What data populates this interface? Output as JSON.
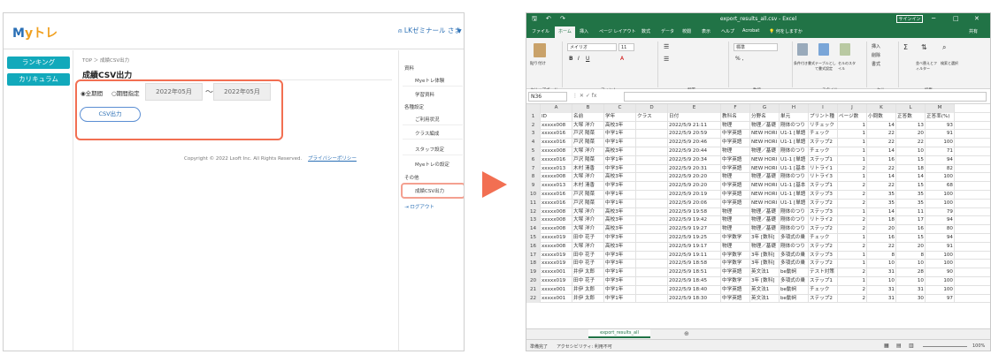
{
  "left": {
    "logo_main": "M",
    "logo_accent": "yトレ",
    "user_name": "LKゼミナール さま",
    "user_drop": "▼",
    "sidebar": [
      "ランキング",
      "カリキュラム"
    ],
    "breadcrumb": "TOP ＞ 成績CSV出力",
    "page_title": "成績CSV出力",
    "radio_all": "◉全期間",
    "radio_range": "○期間指定",
    "date_from": "2022年05月",
    "date_sep": "〜",
    "date_to": "2022年05月",
    "csv_button": "CSV出力",
    "footer_copy": "Copyright © 2022 Lsoft Inc. All Rights Reserved.",
    "footer_link": "プライバシーポリシー",
    "rside": {
      "sec1": "資料",
      "sec1_items": [
        "Myeトレ体験",
        "学習資料"
      ],
      "sec2": "各種設定",
      "sec2_items": [
        "ご利用状況",
        "クラス編成",
        "スタッフ設定",
        "Myeトレの設定"
      ],
      "sec3": "その他",
      "sec3_items": [
        "成績CSV出力"
      ],
      "logout": "⇥ ログアウト"
    }
  },
  "excel": {
    "title": "export_results_all.csv - Excel",
    "signin": "サインイン",
    "window_controls": [
      "─",
      "□",
      "✕"
    ],
    "tabs": [
      "ファイル",
      "ホーム",
      "挿入",
      "ページ レイアウト",
      "数式",
      "データ",
      "校閲",
      "表示",
      "ヘルプ",
      "Acrobat",
      "💡 何をしますか"
    ],
    "share": "共有",
    "ribbon_groups": [
      "クリップボード",
      "フォント",
      "配置",
      "数値",
      "スタイル",
      "セル",
      "編集"
    ],
    "font_name": "メイリオ",
    "font_size": "11",
    "number_format": "標準",
    "ribbon_labels": [
      "貼り付け",
      "条件付き書式",
      "テーブルとして書式設定",
      "セルのスタイル",
      "挿入",
      "削除",
      "書式",
      "並べ替えとフィルター",
      "検索と選択"
    ],
    "name_box": "N36",
    "formula_icons": "⋮   ✕  ✓  fx",
    "columns": [
      "A",
      "B",
      "C",
      "D",
      "E",
      "F",
      "G",
      "H",
      "I",
      "J",
      "K",
      "L",
      "M"
    ],
    "rows": [
      [
        "ID",
        "名前",
        "学年",
        "クラス",
        "日付",
        "教科名",
        "分野名",
        "単元",
        "プリント種",
        "ページ数",
        "小問数",
        "正答数",
        "正答率(%)"
      ],
      [
        "xxxxx008",
        "大塚 洋介",
        "高校3年",
        "",
        "2022/5/9 21:11",
        "物理",
        "物理／基礎",
        "剛体のつり",
        "リチェック",
        "1",
        "14",
        "13",
        "93"
      ],
      [
        "xxxxx016",
        "戸沢 陽菜",
        "中学1年",
        "",
        "2022/5/9 20:59",
        "中学英語",
        "NEW HORI",
        "U1-1 [単語",
        "チェック",
        "1",
        "22",
        "20",
        "91"
      ],
      [
        "xxxxx016",
        "戸沢 陽菜",
        "中学1年",
        "",
        "2022/5/9 20:46",
        "中学英語",
        "NEW HORI",
        "U1-1 [単語",
        "ステップ2",
        "1",
        "22",
        "22",
        "100"
      ],
      [
        "xxxxx008",
        "大塚 洋介",
        "高校3年",
        "",
        "2022/5/9 20:44",
        "物理",
        "物理／基礎",
        "剛体のつり",
        "チェック",
        "1",
        "14",
        "10",
        "71"
      ],
      [
        "xxxxx016",
        "戸沢 陽菜",
        "中学1年",
        "",
        "2022/5/9 20:34",
        "中学英語",
        "NEW HORI",
        "U1-1 [単語",
        "ステップ1",
        "1",
        "16",
        "15",
        "94"
      ],
      [
        "xxxxx013",
        "木村 清香",
        "中学3年",
        "",
        "2022/5/9 20:31",
        "中学英語",
        "NEW HORI",
        "U1-1 [基本",
        "リトライ1",
        "2",
        "22",
        "18",
        "82"
      ],
      [
        "xxxxx008",
        "大塚 洋介",
        "高校3年",
        "",
        "2022/5/9 20:20",
        "物理",
        "物理／基礎",
        "剛体のつり",
        "リトライ3",
        "1",
        "14",
        "14",
        "100"
      ],
      [
        "xxxxx013",
        "木村 清香",
        "中学3年",
        "",
        "2022/5/9 20:20",
        "中学英語",
        "NEW HORI",
        "U1-1 [基本",
        "ステップ1",
        "2",
        "22",
        "15",
        "68"
      ],
      [
        "xxxxx016",
        "戸沢 陽菜",
        "中学1年",
        "",
        "2022/5/9 20:19",
        "中学英語",
        "NEW HORI",
        "U1-1 [単語",
        "ステップ3",
        "2",
        "35",
        "35",
        "100"
      ],
      [
        "xxxxx016",
        "戸沢 陽菜",
        "中学1年",
        "",
        "2022/5/9 20:06",
        "中学英語",
        "NEW HORI",
        "U1-1 [単語",
        "ステップ2",
        "2",
        "35",
        "35",
        "100"
      ],
      [
        "xxxxx008",
        "大塚 洋介",
        "高校3年",
        "",
        "2022/5/9 19:58",
        "物理",
        "物理／基礎",
        "剛体のつり",
        "ステップ3",
        "1",
        "14",
        "11",
        "79"
      ],
      [
        "xxxxx008",
        "大塚 洋介",
        "高校3年",
        "",
        "2022/5/9 19:42",
        "物理",
        "物理／基礎",
        "剛体のつり",
        "リトライ2",
        "2",
        "18",
        "17",
        "94"
      ],
      [
        "xxxxx008",
        "大塚 洋介",
        "高校3年",
        "",
        "2022/5/9 19:27",
        "物理",
        "物理／基礎",
        "剛体のつり",
        "ステップ2",
        "2",
        "20",
        "16",
        "80"
      ],
      [
        "xxxxx019",
        "田中 花子",
        "中学3年",
        "",
        "2022/5/9 19:25",
        "中学数学",
        "3年 [数科]",
        "多項式の乗",
        "チェック",
        "1",
        "16",
        "15",
        "94"
      ],
      [
        "xxxxx008",
        "大塚 洋介",
        "高校3年",
        "",
        "2022/5/9 19:17",
        "物理",
        "物理／基礎",
        "剛体のつり",
        "ステップ2",
        "2",
        "22",
        "20",
        "91"
      ],
      [
        "xxxxx019",
        "田中 花子",
        "中学3年",
        "",
        "2022/5/9 19:11",
        "中学数学",
        "3年 [数科]",
        "多項式の乗",
        "ステップ3",
        "1",
        "8",
        "8",
        "100"
      ],
      [
        "xxxxx019",
        "田中 花子",
        "中学3年",
        "",
        "2022/5/9 18:58",
        "中学数学",
        "3年 [数科]",
        "多項式の乗",
        "ステップ2",
        "1",
        "10",
        "10",
        "100"
      ],
      [
        "xxxxx001",
        "井伊 太郎",
        "中学1年",
        "",
        "2022/5/9 18:51",
        "中学英語",
        "英文法1",
        "be動詞",
        "テスト対策",
        "2",
        "31",
        "28",
        "90"
      ],
      [
        "xxxxx019",
        "田中 花子",
        "中学3年",
        "",
        "2022/5/9 18:45",
        "中学数学",
        "3年 [数科]",
        "多項式の乗",
        "ステップ1",
        "1",
        "10",
        "10",
        "100"
      ],
      [
        "xxxxx001",
        "井伊 太郎",
        "中学1年",
        "",
        "2022/5/9 18:40",
        "中学英語",
        "英文法1",
        "be動詞",
        "チェック",
        "2",
        "31",
        "31",
        "100"
      ],
      [
        "xxxxx001",
        "井伊 太郎",
        "中学1年",
        "",
        "2022/5/9 18:30",
        "中学英語",
        "英文法1",
        "be動詞",
        "ステップ2",
        "2",
        "31",
        "30",
        "97"
      ]
    ],
    "sheet_tab": "export_results_all",
    "add_sheet": "⊕",
    "status_left": "準備完了",
    "status_access": "アクセシビリティ: 利用不可",
    "zoom": "100%"
  },
  "colors": {
    "accent": "#12a9bb",
    "highlight": "#f26f52",
    "excel_green": "#217346"
  }
}
